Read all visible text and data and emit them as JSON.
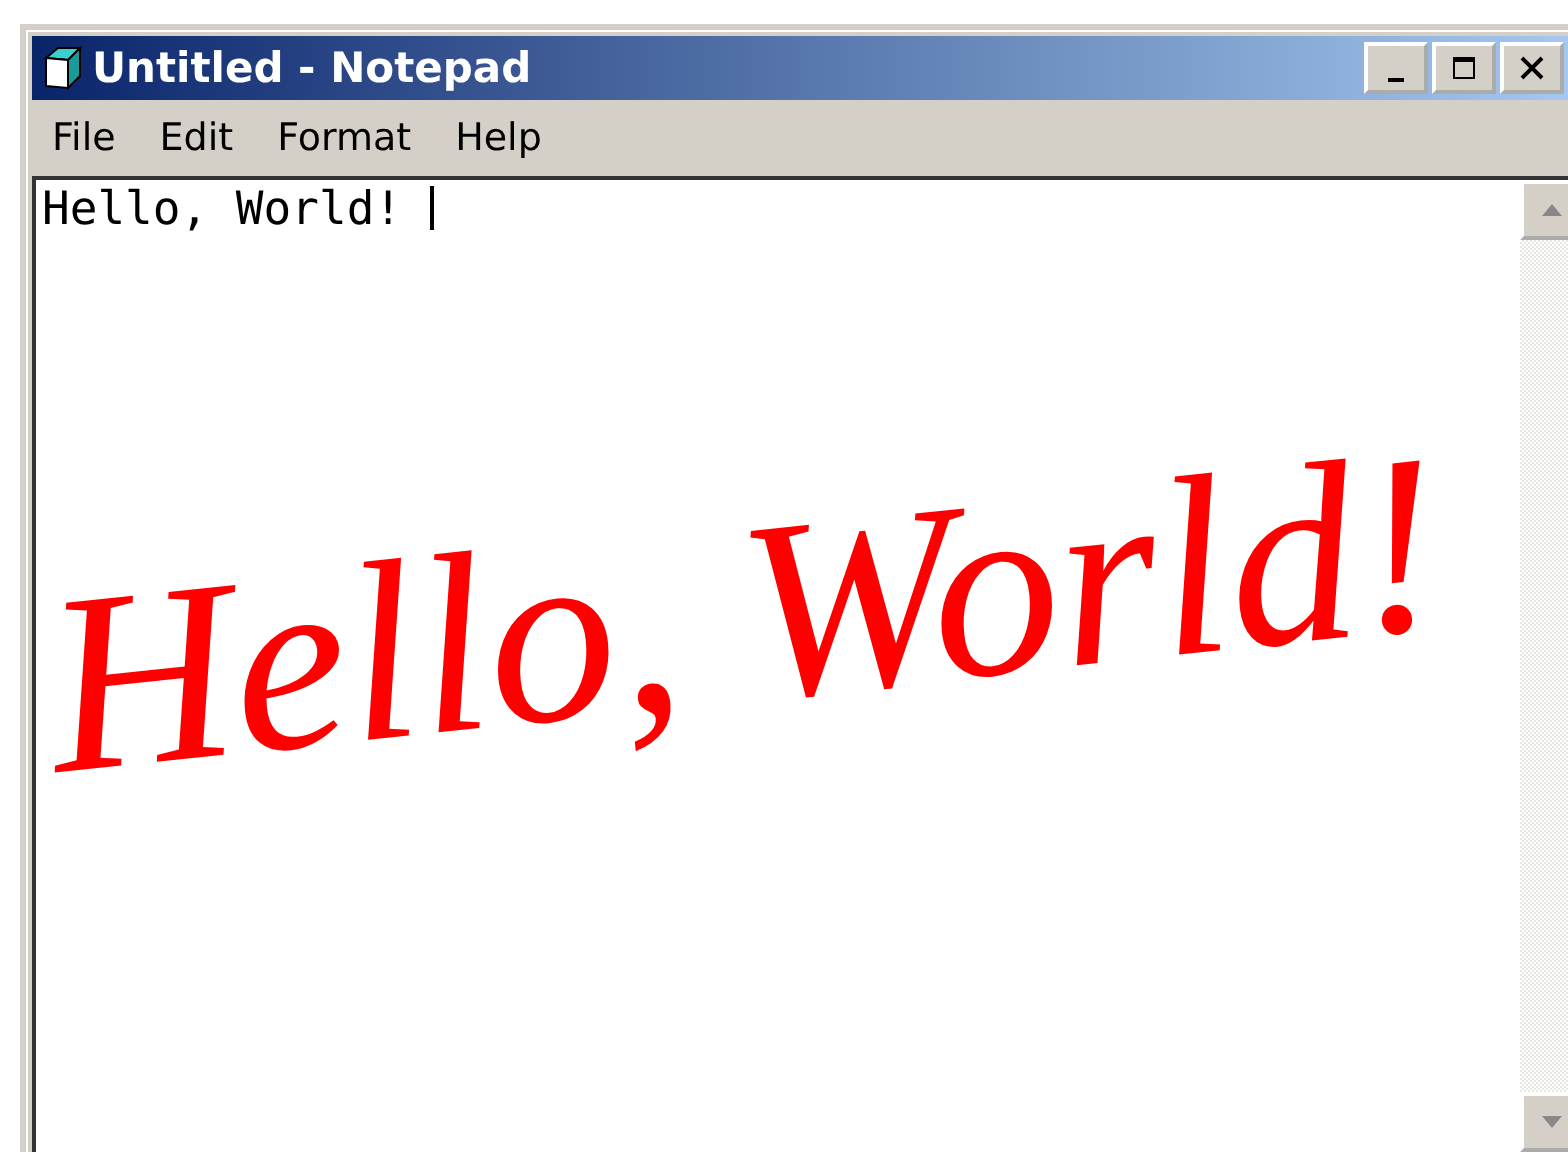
{
  "window": {
    "title": "Untitled - Notepad"
  },
  "menu": [
    "File",
    "Edit",
    "Format",
    "Help"
  ],
  "editor": {
    "value": "Hello, World! "
  },
  "ink_annotation": "Hello, World!"
}
